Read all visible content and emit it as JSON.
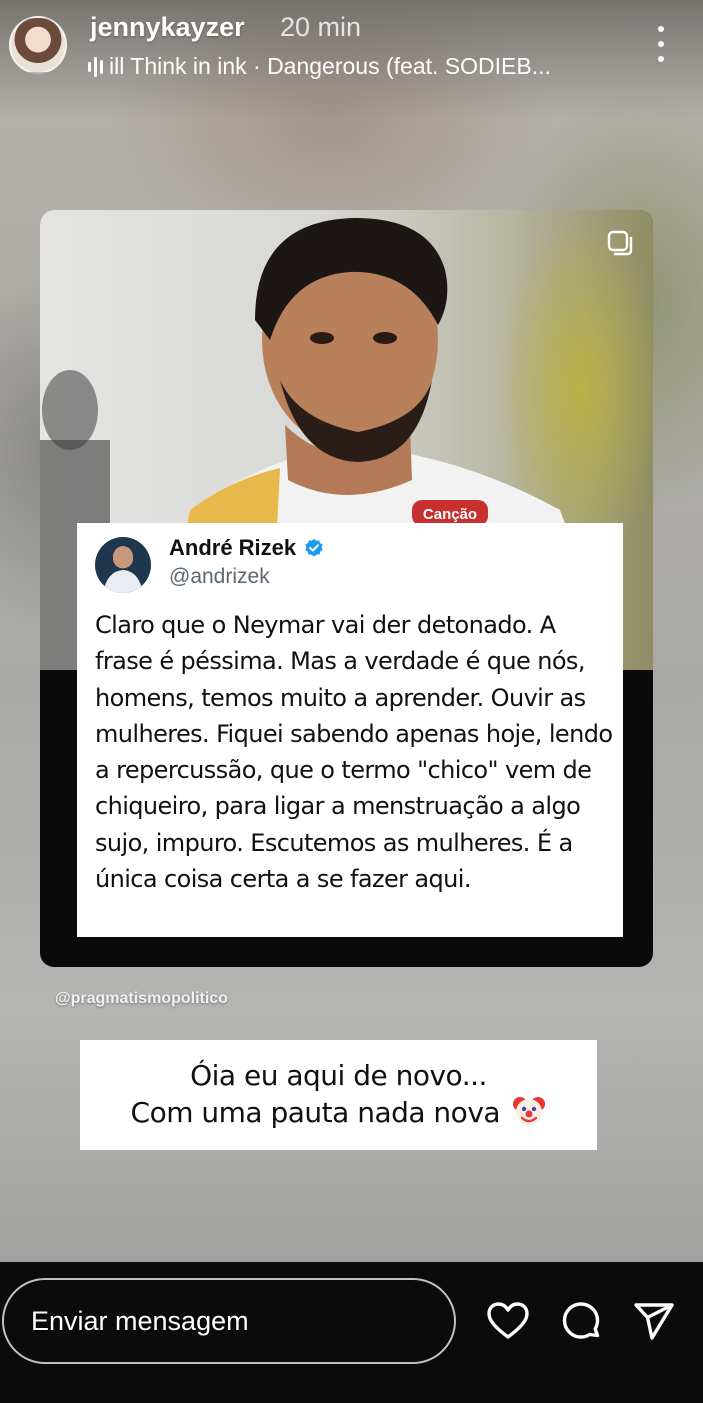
{
  "header": {
    "username": "jennykayzer",
    "timestamp": "20 min",
    "music_text": "ill Think in ink · Dangerous (feat. SODIEB..."
  },
  "post": {
    "tweet": {
      "author_name": "André Rizek",
      "handle": "@andrizek",
      "text": "Claro que o Neymar vai der detonado. A frase é péssima. Mas a verdade é que nós, homens, temos muito a aprender. Ouvir as mulheres. Fiquei sabendo apenas hoje, lendo a repercussão, que o termo \"chico\" vem de chiqueiro, para ligar a menstruação a algo sujo, impuro. Escutemos as mulheres. É a única coisa certa a se fazer aqui."
    },
    "shirt_sponsor": "Canção"
  },
  "credit": "@pragmatismopolitico",
  "caption": {
    "line1": "Óia eu aqui de novo...",
    "line2": "Com uma pauta nada nova"
  },
  "footer": {
    "message_placeholder": "Enviar mensagem"
  },
  "icons": {
    "more": "more-vertical-icon",
    "audio": "audio-bars-icon",
    "carousel": "carousel-icon",
    "verified": "verified-badge-icon",
    "clown": "clown-emoji-icon",
    "like": "heart-icon",
    "reply": "chat-bubble-icon",
    "share": "send-icon"
  },
  "colors": {
    "verified": "#1d9bf0",
    "background": "#0b0b0b",
    "tweet_bg": "#ffffff"
  }
}
